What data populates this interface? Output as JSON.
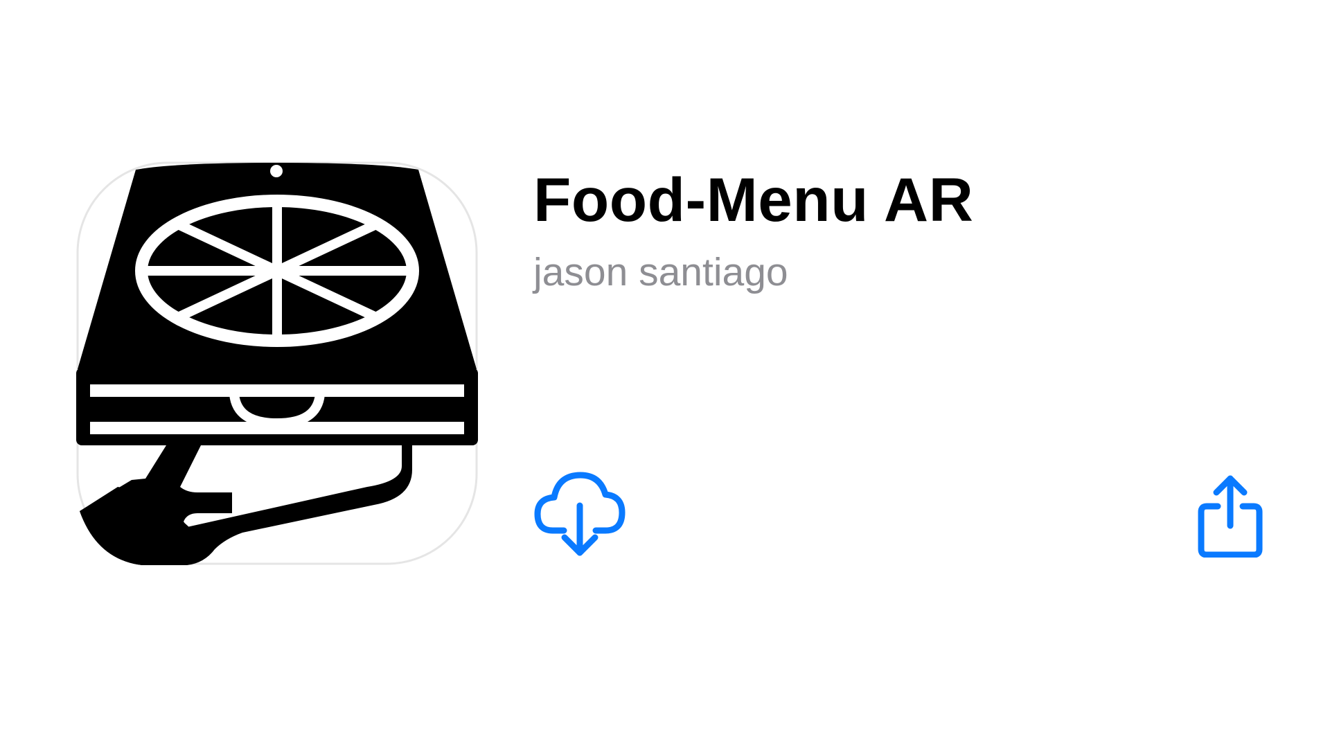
{
  "app": {
    "title": "Food-Menu AR",
    "developer": "jason santiago",
    "icon": "pizza-box-on-hand-icon"
  },
  "actions": {
    "download_icon": "cloud-download-icon",
    "share_icon": "share-icon"
  },
  "colors": {
    "accent": "#0a7aff",
    "title": "#000000",
    "subtitle": "#8e8e93",
    "icon_fill": "#000000",
    "icon_border": "#e5e5e5"
  }
}
